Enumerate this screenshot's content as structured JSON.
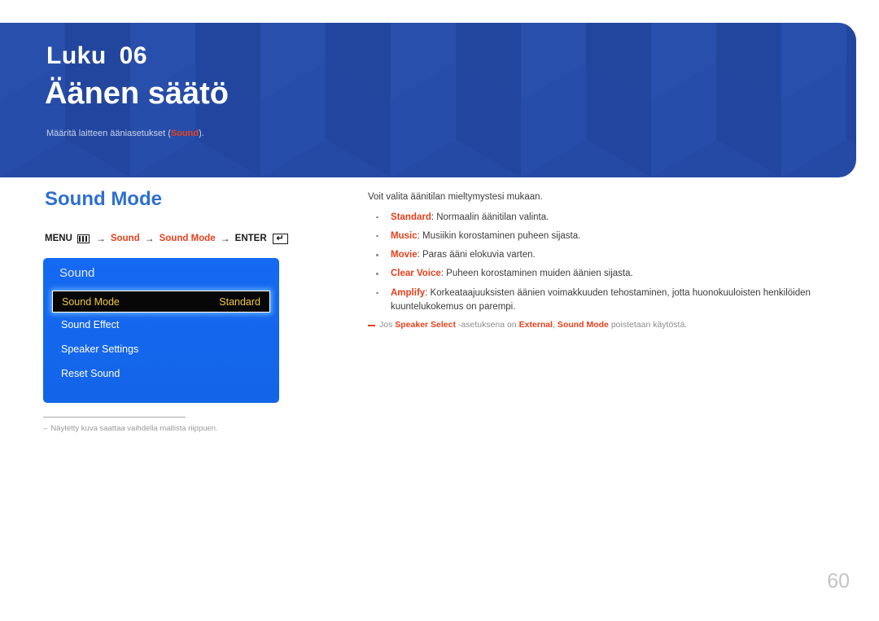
{
  "header": {
    "chapter_label": "Luku",
    "chapter_number": "06",
    "chapter_title": "Äänen säätö",
    "subtitle_prefix": "Määritä laitteen ääniasetukset (",
    "subtitle_accent": "Sound",
    "subtitle_suffix": ").",
    "bg_color": "#254aa5",
    "accent_color": "#e8401c"
  },
  "section": {
    "title": "Sound Mode",
    "title_color": "#2f6fd0"
  },
  "menu_path": {
    "menu_label": "MENU",
    "menu_icon": "menu-bars-icon",
    "arrow": "→",
    "step_1": "Sound",
    "step_2": "Sound Mode",
    "enter_label": "ENTER",
    "enter_icon": "enter-return-icon",
    "enter_glyph": "↵"
  },
  "osd": {
    "title": "Sound",
    "rows": [
      {
        "label": "Sound Mode",
        "value": "Standard",
        "selected": true
      },
      {
        "label": "Sound Effect",
        "value": "",
        "selected": false
      },
      {
        "label": "Speaker Settings",
        "value": "",
        "selected": false
      },
      {
        "label": "Reset Sound",
        "value": "",
        "selected": false
      }
    ],
    "bg_color": "#1567f0",
    "selected_text_color": "#f3c73f"
  },
  "footnote": {
    "dash": "–",
    "text": "Näytetty kuva saattaa vaihdella mallista riippuen."
  },
  "right": {
    "intro": "Voit valita äänitilan mieltymystesi mukaan.",
    "bullets": [
      {
        "term": "Standard",
        "rest": ": Normaalin äänitilan valinta."
      },
      {
        "term": "Music",
        "rest": ": Musiikin korostaminen puheen sijasta."
      },
      {
        "term": "Movie",
        "rest": ": Paras ääni elokuvia varten."
      },
      {
        "term": "Clear Voice",
        "rest": ": Puheen korostaminen muiden äänien sijasta."
      },
      {
        "term": "Amplify",
        "rest": ": Korkeataajuuksisten äänien voimakkuuden tehostaminen, jotta huonokuuloisten henkilöiden kuuntelukokemus on parempi."
      }
    ],
    "note": {
      "p1": "Jos ",
      "b1": "Speaker Select",
      "p2": " -asetuksena on ",
      "b2": "External",
      "p3": ", ",
      "b3": "Sound Mode",
      "p4": " poistetaan käytöstä."
    }
  },
  "page_number": "60"
}
